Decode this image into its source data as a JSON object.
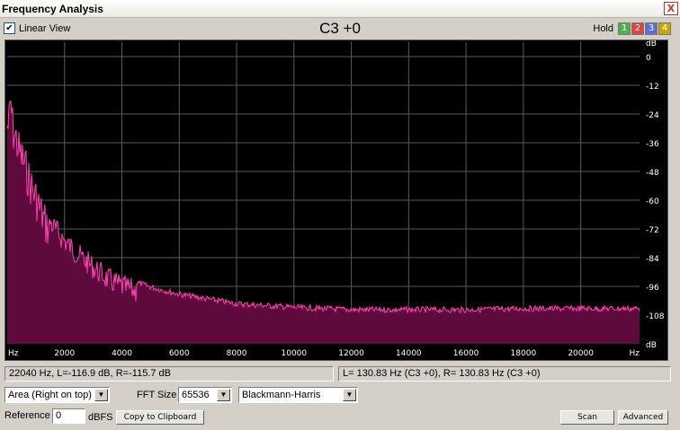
{
  "window": {
    "title": "Frequency Analysis",
    "close_glyph": "X"
  },
  "view": {
    "linear_view_label": "Linear View",
    "linear_view_checked": true,
    "check_glyph": "✔"
  },
  "pitch": "C3 +0",
  "hold": {
    "label": "Hold",
    "buttons": [
      {
        "label": "1",
        "color": "#4caf50"
      },
      {
        "label": "2",
        "color": "#e0443a"
      },
      {
        "label": "3",
        "color": "#5b6fd8"
      },
      {
        "label": "4",
        "color": "#c8a800"
      }
    ]
  },
  "chart_data": {
    "type": "area",
    "x_ticks": [
      "Hz",
      "2000",
      "4000",
      "6000",
      "8000",
      "10000",
      "12000",
      "14000",
      "16000",
      "18000",
      "20000",
      "Hz"
    ],
    "x_tick_values": [
      0,
      2000,
      4000,
      6000,
      8000,
      10000,
      12000,
      14000,
      16000,
      18000,
      20000,
      22050
    ],
    "y_ticks": [
      "dB",
      "0",
      "-12",
      "-24",
      "-36",
      "-48",
      "-60",
      "-72",
      "-84",
      "-96",
      "-108",
      "dB"
    ],
    "y_tick_values": [
      6,
      0,
      -12,
      -24,
      -36,
      -48,
      -60,
      -72,
      -84,
      -96,
      -108,
      -120
    ],
    "xlim": [
      0,
      22050
    ],
    "ylim": [
      -120,
      6
    ],
    "grid": true,
    "fill_color": "#5e0a3c",
    "line_color": "#ff40b0",
    "envelope": {
      "x": [
        50,
        130,
        200,
        300,
        400,
        600,
        800,
        1000,
        1300,
        1600,
        2000,
        2500,
        3000,
        3500,
        4000,
        5000,
        6000,
        7000,
        8000,
        10000,
        12000,
        14000,
        16000,
        18000,
        20000,
        22040
      ],
      "y": [
        -20,
        -10,
        -22,
        -25,
        -30,
        -36,
        -44,
        -50,
        -60,
        -66,
        -72,
        -78,
        -83,
        -88,
        -91,
        -95,
        -98,
        -100,
        -102,
        -103.5,
        -104.5,
        -104.5,
        -104.5,
        -104,
        -104,
        -104
      ]
    }
  },
  "status": {
    "left": "22040 Hz, L=-116.9 dB, R=-115.7 dB",
    "right": "L= 130.83 Hz (C3 +0), R= 130.83 Hz (C3 +0)"
  },
  "controls": {
    "display_mode": "Area (Right on top)",
    "fft_size_label": "FFT Size",
    "fft_size": "65536",
    "window_function": "Blackmann-Harris",
    "reference_label": "Reference",
    "reference_value": "0",
    "reference_unit": "dBFS",
    "copy_label": "Copy to Clipboard",
    "scan_label": "Scan",
    "advanced_label": "Advanced",
    "dropdown_glyph": "▼"
  }
}
